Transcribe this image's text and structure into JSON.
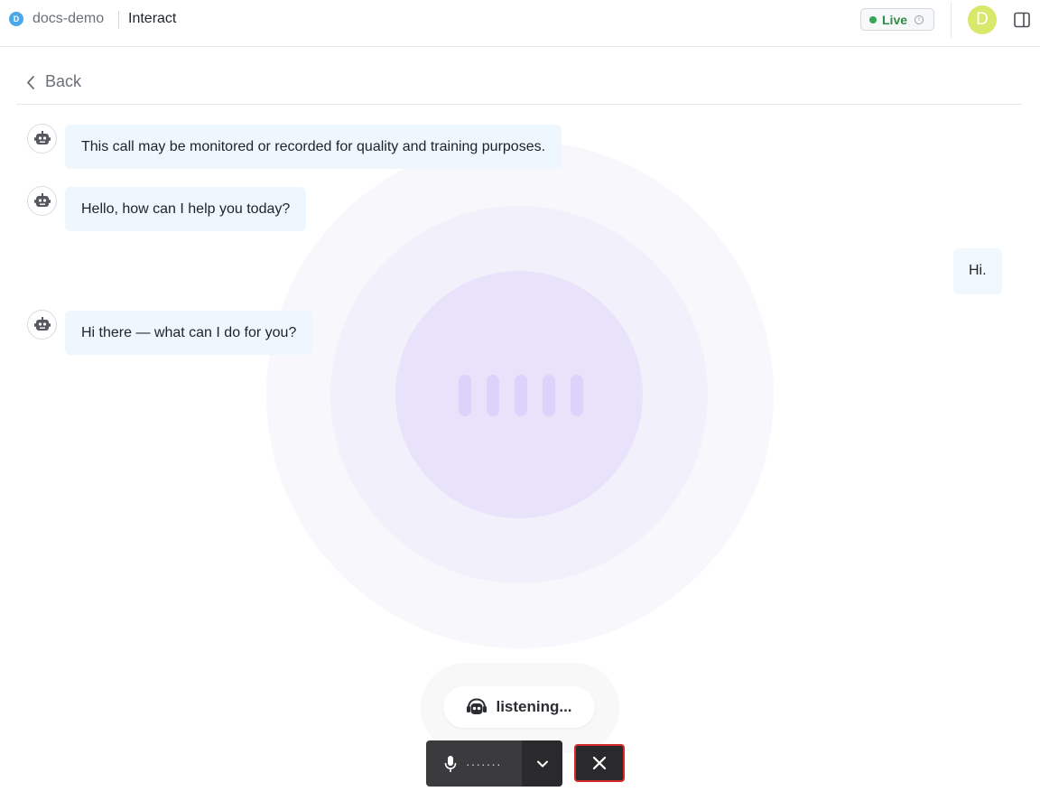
{
  "header": {
    "workspace_initial": "D",
    "workspace_name": "docs-demo",
    "page_name": "Interact",
    "status_label": "Live",
    "user_initial": "D"
  },
  "nav": {
    "back_label": "Back"
  },
  "conversation": {
    "messages": [
      {
        "role": "bot",
        "text": "This call may be monitored or recorded for quality and training purposes."
      },
      {
        "role": "bot",
        "text": "Hello, how can I help you today?"
      },
      {
        "role": "user",
        "text": "Hi."
      },
      {
        "role": "bot",
        "text": "Hi there — what can I do for you?"
      }
    ]
  },
  "voice": {
    "status_text": "listening...",
    "mic_level_indicator": "·······"
  },
  "colors": {
    "live_green": "#34a853",
    "bot_bubble": "#eef7fd",
    "visualizer_core": "#e8e3fb",
    "end_call_border": "#d42a2a",
    "avatar": "#d8e86a"
  },
  "icons": {
    "workspace": "workspace-badge-icon",
    "info": "info-icon",
    "panel": "side-panel-toggle-icon",
    "back": "chevron-left-icon",
    "bot": "robot-icon",
    "agent": "headset-robot-icon",
    "mic": "microphone-icon",
    "dropdown": "chevron-down-icon",
    "end": "close-icon"
  }
}
